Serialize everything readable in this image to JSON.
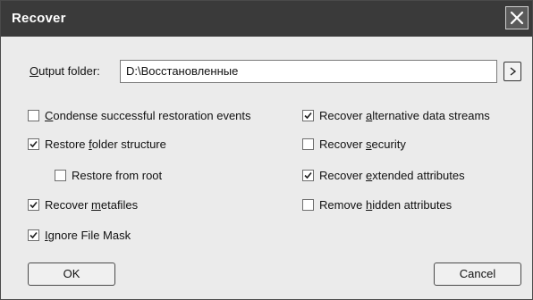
{
  "dialog": {
    "title": "Recover",
    "close_icon": "close-icon"
  },
  "output": {
    "label_mnemonic": "O",
    "label_rest": "utput folder:",
    "value": "D:\\Восстановленные",
    "browse_icon": "chevron-right-icon"
  },
  "options": {
    "condense": {
      "pre": "",
      "key": "C",
      "post": "ondense successful restoration events",
      "checked": false
    },
    "restore_folder": {
      "pre": "Restore ",
      "key": "f",
      "post": "older structure",
      "checked": true
    },
    "restore_root": {
      "pre": "Restore from root",
      "key": "",
      "post": "",
      "checked": false
    },
    "recover_metafiles": {
      "pre": "Recover ",
      "key": "m",
      "post": "etafiles",
      "checked": true
    },
    "ignore_mask": {
      "pre": "",
      "key": "I",
      "post": "gnore File Mask",
      "checked": true
    },
    "alt_streams": {
      "pre": "Recover ",
      "key": "a",
      "post": "lternative data streams",
      "checked": true
    },
    "security": {
      "pre": "Recover ",
      "key": "s",
      "post": "ecurity",
      "checked": false
    },
    "ext_attrs": {
      "pre": "Recover ",
      "key": "e",
      "post": "xtended attributes",
      "checked": true
    },
    "hidden_attrs": {
      "pre": "Remove ",
      "key": "h",
      "post": "idden attributes",
      "checked": false
    }
  },
  "buttons": {
    "ok": "OK",
    "cancel": "Cancel"
  }
}
